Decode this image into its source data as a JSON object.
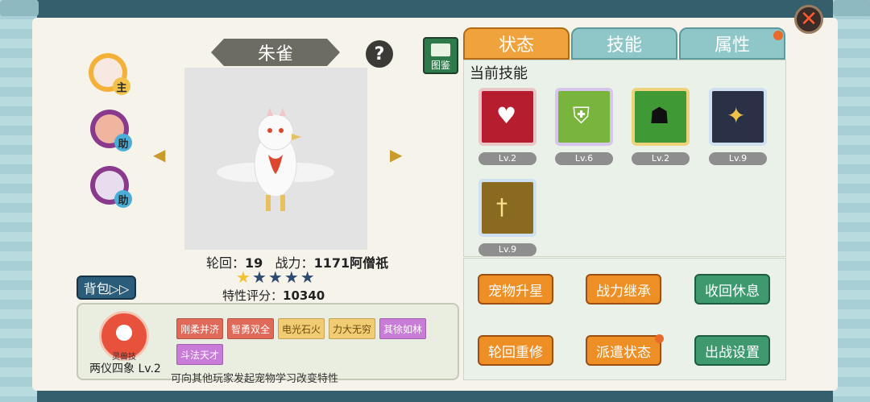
{
  "pet": {
    "name": "朱雀",
    "rebirth_label": "轮回：",
    "rebirth_value": "19",
    "power_label": "战力：",
    "power_value": "1171阿僧祇",
    "stars_filled": 1,
    "stars_total": 5,
    "score_label": "特性评分：",
    "score_value": "10340"
  },
  "pet_list": [
    {
      "tag": "主",
      "color": "#f3b13a"
    },
    {
      "tag": "助",
      "color": "#8a3a8d"
    },
    {
      "tag": "助",
      "color": "#8a3a8d"
    }
  ],
  "buttons": {
    "close": "✕",
    "help": "?",
    "codex": "图鉴",
    "bag": "背包▷▷",
    "prev": "◀",
    "next": "▶"
  },
  "tabs": [
    {
      "label": "状态",
      "active": true
    },
    {
      "label": "技能",
      "active": false
    },
    {
      "label": "属性",
      "active": false
    }
  ],
  "skills": {
    "title": "当前技能",
    "items": [
      {
        "icon": "heart-skill-icon",
        "level": "Lv.2",
        "color": "#b61e2f"
      },
      {
        "icon": "leaf-shield-skill-icon",
        "level": "Lv.6",
        "color": "#79b53c"
      },
      {
        "icon": "shadow-warrior-skill-icon",
        "level": "Lv.2",
        "color": "#3f9a36"
      },
      {
        "icon": "golden-hand-skill-icon",
        "level": "Lv.9",
        "color": "#2a3046"
      },
      {
        "icon": "sword-light-skill-icon",
        "level": "Lv.9",
        "color": "#8a6a20"
      }
    ]
  },
  "actions": [
    {
      "label": "宠物升星",
      "style": "orange"
    },
    {
      "label": "战力继承",
      "style": "orange"
    },
    {
      "label": "收回休息",
      "style": "green"
    },
    {
      "label": "轮回重修",
      "style": "orange"
    },
    {
      "label": "派遣状态",
      "style": "orange"
    },
    {
      "label": "出战设置",
      "style": "green"
    }
  ],
  "trait": {
    "emblem_text": "灵兽技",
    "name": "两仪四象 Lv.2",
    "tags": [
      {
        "label": "刚柔并济",
        "color": "#e06a5a"
      },
      {
        "label": "智勇双全",
        "color": "#e06a5a"
      },
      {
        "label": "电光石火",
        "color": "#f2cc72"
      },
      {
        "label": "力大无穷",
        "color": "#f2cc72"
      },
      {
        "label": "其徐如林",
        "color": "#c97bd8"
      },
      {
        "label": "斗法天才",
        "color": "#c97bd8"
      }
    ],
    "hint": "可向其他玩家发起宠物学习改变特性"
  }
}
